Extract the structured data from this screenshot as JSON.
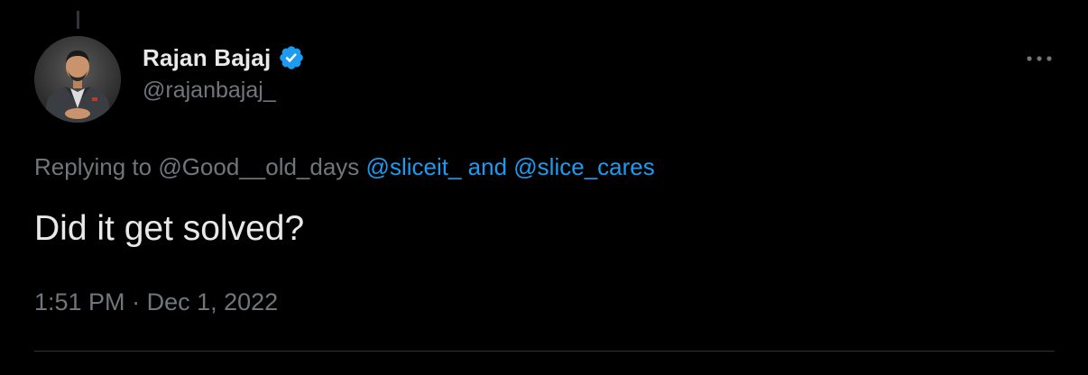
{
  "author": {
    "display_name": "Rajan Bajaj",
    "handle": "@rajanbajaj_",
    "verified": true,
    "avatar_icon": "profile-photo"
  },
  "reply_context": {
    "prefix": "Replying to",
    "first_mention": "@Good__old_days",
    "second_mention": "@sliceit_",
    "joiner": "and",
    "third_mention": "@slice_cares"
  },
  "tweet": {
    "text": "Did it get solved?",
    "time": "1:51 PM",
    "separator": "·",
    "date": "Dec 1, 2022"
  },
  "more_icon": "more-horizontal-icon",
  "colors": {
    "background": "#000000",
    "text_primary": "#e7e9ea",
    "text_secondary": "#71767b",
    "accent": "#1d9bf0",
    "divider": "#2f3336"
  }
}
